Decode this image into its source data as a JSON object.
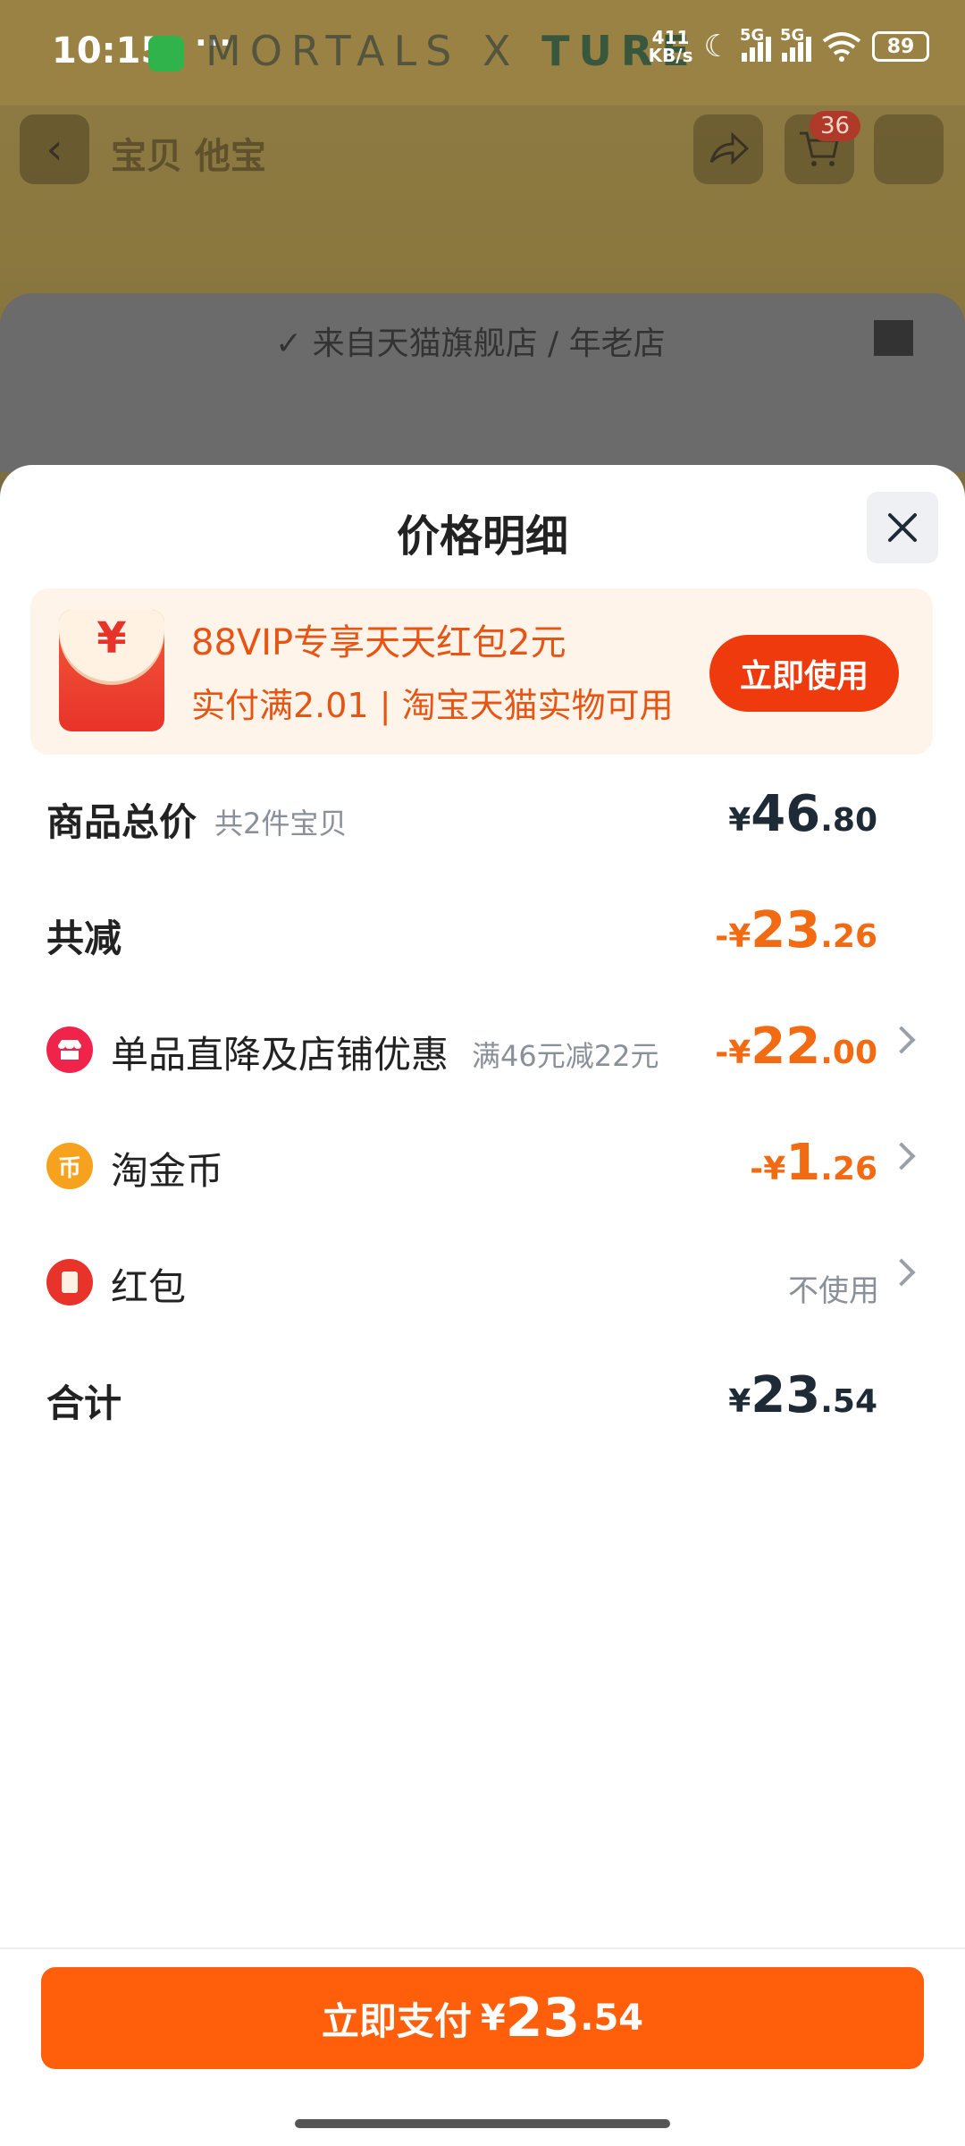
{
  "status": {
    "time": "10:15",
    "net_speed_value": "411",
    "net_speed_unit": "KB/s",
    "battery": "89",
    "signal1_label": "5G",
    "signal2_label": "5G",
    "brand_overlay_a": "MORTALS X ",
    "brand_overlay_b": "TURE"
  },
  "nav": {
    "title": "宝贝 他宝",
    "cart_count": "36"
  },
  "store": {
    "text": "✓ 来自天猫旗舰店 / 年老店"
  },
  "sheet": {
    "title": "价格明细"
  },
  "promo": {
    "line1": "88VIP专享天天红包2元",
    "line2": "实付满2.01 | 淘宝天猫实物可用",
    "button": "立即使用",
    "icon_symbol": "¥"
  },
  "rows": {
    "total_goods": {
      "label": "商品总价",
      "sub": "共2件宝贝",
      "currency": "¥",
      "int": "46",
      "dec": ".80"
    },
    "total_reduce": {
      "label": "共减",
      "currency": "-¥",
      "int": "23",
      "dec": ".26"
    },
    "shop_discount": {
      "label": "单品直降及店铺优惠",
      "sub": "满46元减22元",
      "currency": "-¥",
      "int": "22",
      "dec": ".00"
    },
    "tao_coin": {
      "label": "淘金币",
      "currency": "-¥",
      "int": "1",
      "dec": ".26",
      "icon_symbol": "币"
    },
    "red_packet": {
      "label": "红包",
      "value": "不使用"
    },
    "sum": {
      "label": "合计",
      "currency": "¥",
      "int": "23",
      "dec": ".54"
    }
  },
  "pay": {
    "label": "立即支付",
    "currency": "¥",
    "int": "23",
    "dec": ".54"
  },
  "colors": {
    "accent_orange": "#ff5e0a",
    "discount_orange": "#f26a12",
    "promo_button": "#ee3a0c"
  }
}
